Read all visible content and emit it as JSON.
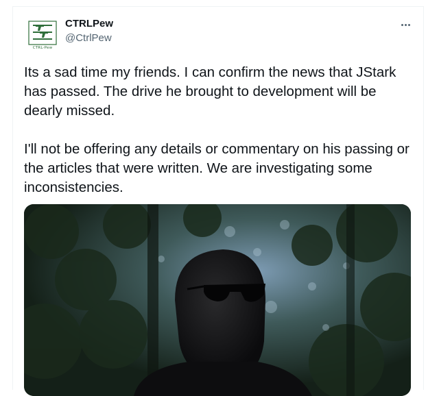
{
  "tweet": {
    "author": {
      "display_name": "CTRLPew",
      "handle": "@CtrlPew",
      "avatar_logo_text": "CTRL-Pew"
    },
    "menu_icon": "more-dots-icon",
    "paragraphs": [
      "Its a sad time my friends. I can confirm the news that JStark has passed. The drive he brought to development will be dearly missed.",
      "I'll not be offering any details or commentary on his passing or the articles that were written. We are investigating some inconsistencies."
    ],
    "media": {
      "type": "photo",
      "subject": "masked-figure-in-sunglasses-forest"
    }
  },
  "colors": {
    "text_primary": "#0f1419",
    "text_secondary": "#536471",
    "logo_green": "#2f6e3a",
    "border": "#eff3f4"
  }
}
